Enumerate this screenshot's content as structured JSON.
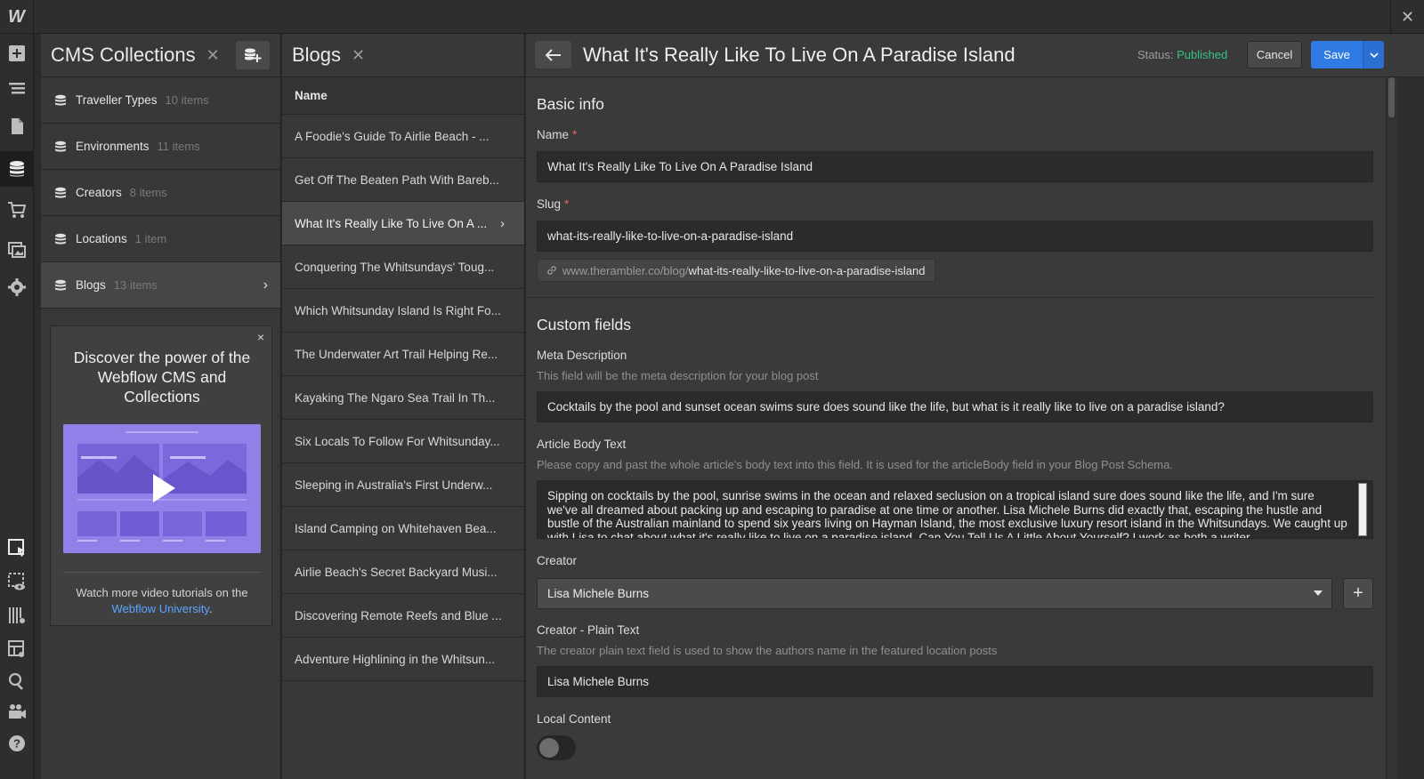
{
  "app": {
    "logo": "W",
    "close_icon": "✕"
  },
  "toolbar": {
    "top_icons": [
      "add-icon",
      "navigator-icon",
      "pages-icon",
      "cms-icon",
      "ecommerce-icon",
      "assets-icon",
      "settings-icon"
    ],
    "bottom_icons": [
      "select-icon",
      "preview-icon",
      "grid-icon",
      "layout-icon",
      "search-icon",
      "video-icon",
      "help-icon"
    ]
  },
  "collections": {
    "title": "CMS Collections",
    "close": "✕",
    "items": [
      {
        "name": "Traveller Types",
        "count": "10 items"
      },
      {
        "name": "Environments",
        "count": "11 items"
      },
      {
        "name": "Creators",
        "count": "8 items"
      },
      {
        "name": "Locations",
        "count": "1 item"
      },
      {
        "name": "Blogs",
        "count": "13 items",
        "chevron": "›"
      }
    ]
  },
  "promo": {
    "close": "×",
    "title": "Discover the power of the Webflow CMS and Collections",
    "text_before": "Watch more video tutorials on the ",
    "link": "Webflow University",
    "text_after": "."
  },
  "blogs": {
    "title": "Blogs",
    "close": "✕",
    "column": "Name",
    "rows": [
      "A Foodie's Guide To Airlie Beach - ...",
      "Get Off The Beaten Path With Bareb...",
      "What It's Really Like To Live On A ...",
      "Conquering The Whitsundays' Toug...",
      "Which Whitsunday Island Is Right Fo...",
      "The Underwater Art Trail Helping Re...",
      "Kayaking The Ngaro Sea Trail In Th...",
      "Six Locals To Follow For Whitsunday...",
      "Sleeping in Australia's First Underw...",
      "Island Camping on Whitehaven Bea...",
      "Airlie Beach's Secret Backyard Musi...",
      "Discovering Remote Reefs and Blue ...",
      "Adventure Highlining in the Whitsun..."
    ],
    "active_chevron": "›"
  },
  "editor": {
    "title": "What It's Really Like To Live On A Paradise Island",
    "status_label": "Status: ",
    "status_value": "Published",
    "cancel": "Cancel",
    "save": "Save",
    "basic_info": "Basic info",
    "name_label": "Name",
    "name_value": "What It's Really Like To Live On A Paradise Island",
    "slug_label": "Slug",
    "slug_value": "what-its-really-like-to-live-on-a-paradise-island",
    "slug_url_prefix": "www.therambler.co/blog/",
    "slug_url_tail": "what-its-really-like-to-live-on-a-paradise-island",
    "required_mark": "*",
    "custom_fields": "Custom fields",
    "meta_label": "Meta Description",
    "meta_help": "This field will be the meta description for your blog post",
    "meta_value": "Cocktails by the pool and sunset ocean swims sure does sound like the life, but what is it really like to live on a paradise island?",
    "body_label": "Article Body Text",
    "body_help": "Please copy and past the whole article's body text into this field. It is used for the articleBody field in your Blog Post Schema.",
    "body_value": "Sipping on cocktails by the pool, sunrise swims in the ocean and relaxed seclusion on a tropical island sure does sound like the life, and I'm sure we've all dreamed about packing up and escaping to paradise at one time or another. Lisa Michele Burns did exactly that, escaping the hustle and bustle of the Australian mainland to spend six years living on Hayman Island, the most exclusive luxury resort island in the Whitsundays. We caught up with Lisa to chat about what it's really like to live on a paradise island. Can You Tell Us A Little About Yourself? I work as both a writer",
    "creator_label": "Creator",
    "creator_value": "Lisa Michele Burns",
    "creator_add": "+",
    "creator_plain_label": "Creator - Plain Text",
    "creator_plain_help": "The creator plain text field is used to show the authors name in the featured location posts",
    "creator_plain_value": "Lisa Michele Burns",
    "local_label": "Local Content"
  }
}
